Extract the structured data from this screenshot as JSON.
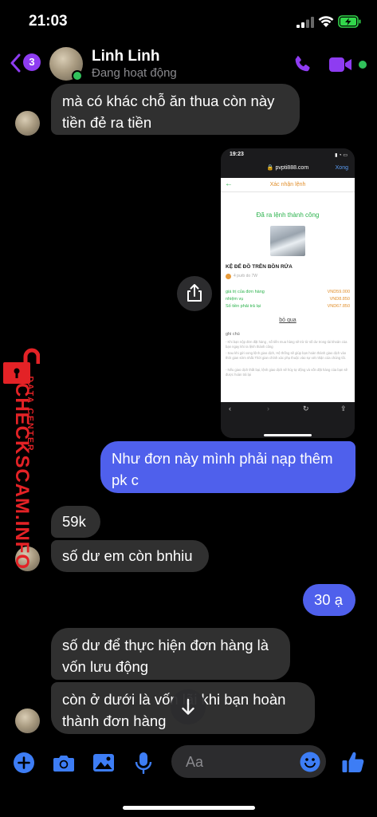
{
  "status_bar": {
    "time": "21:03"
  },
  "header": {
    "back_badge": "3",
    "contact_name": "Linh Linh",
    "contact_status": "Đang hoạt động"
  },
  "messages": [
    {
      "from": "contact",
      "text_lines": [
        "mà có khác chỗ ăn thua còn này",
        "tiền đẻ ra tiền"
      ]
    },
    {
      "from": "me",
      "type": "screenshot"
    },
    {
      "from": "me",
      "text_lines": [
        "Như đơn này mình phải nạp thêm",
        "pk c"
      ]
    },
    {
      "from": "contact",
      "text": "59k"
    },
    {
      "from": "contact",
      "text": "số dư em còn bnhiu"
    },
    {
      "from": "me",
      "text": "30 ạ"
    },
    {
      "from": "contact",
      "text_lines": [
        "số dư để thực hiện đơn hàng là",
        "vốn lưu động"
      ]
    },
    {
      "from": "contact",
      "text_lines": [
        "còn ở dưới là vốn lãi khi bạn hoàn",
        "thành đơn hàng"
      ]
    }
  ],
  "screenshot": {
    "time": "19:23",
    "url": "pvpti888.com",
    "done_label": "Xong",
    "nav_title": "Xác nhận lệnh",
    "success_text": "Đã ra lệnh thành công",
    "product_name": "KỆ ĐỂ ĐỒ TRÊN BỒN RỬA",
    "order_id": "4 purb do 7W",
    "rows": [
      {
        "label": "giá trị của đơn hàng",
        "value": "VND59.000"
      },
      {
        "label": "nhiệm vụ",
        "value": "VND8.850"
      },
      {
        "label": "Số tiền phải trả lại",
        "value": "VND67.850"
      }
    ],
    "skip_label": "bỏ qua",
    "note_title": "ghi chú",
    "notes": [
      "- Khi bạn nộp đơn đặt hàng , số tiền mua hàng sẽ trừ từ số dư trong tài khoản của bạn ngay khi ra lệnh thành công",
      "- Sau khi gửi xong lệnh giao dịch, Hệ thống sẽ giúp bạn hoàn thành giao dịch vào thời gian sớm nhất.Thời gian chính xác phụ thuộc vào sự xét nhận của chúng tôi.",
      "- Nếu giao dịch thất bại, lệnh giao dịch sẽ hủy tự động và vốn đặt hàng của bạn sẽ được hoàn trả lại"
    ]
  },
  "watermark": {
    "big": "CHECKSCAM.INFO",
    "small": "DATA CENTER"
  },
  "composer": {
    "placeholder": "Aa"
  },
  "colors": {
    "accent": "#8e3cf1",
    "sent_bubble": "#4f60ec",
    "received_bubble": "#303030",
    "online": "#31c15b",
    "composer_icon": "#3d7df5",
    "watermark": "#e32226"
  }
}
